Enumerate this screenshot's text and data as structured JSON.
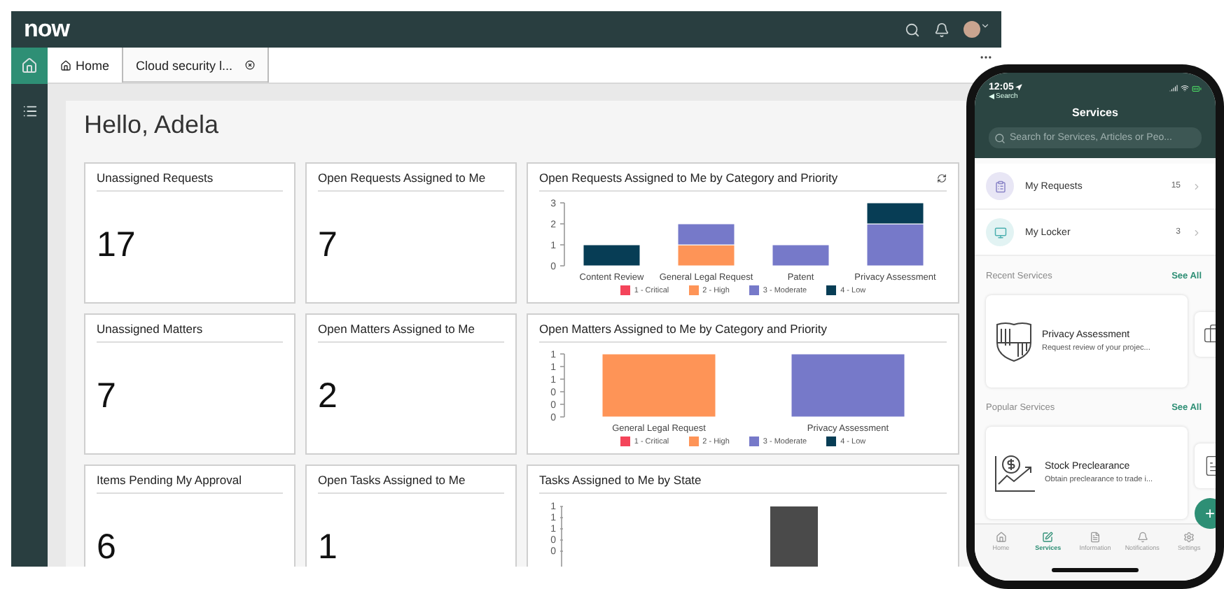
{
  "app": {
    "logo": "now",
    "tabs": [
      {
        "label": "Home",
        "selected": true,
        "closable": false
      },
      {
        "label": "Cloud security l...",
        "selected": false,
        "closable": true
      }
    ]
  },
  "greeting": "Hello, Adela",
  "widgets": [
    {
      "kind": "stat",
      "title": "Unassigned Requests",
      "value": "17"
    },
    {
      "kind": "stat",
      "title": "Open Requests Assigned to Me",
      "value": "7"
    },
    {
      "kind": "chart",
      "title": "Open Requests Assigned to Me by Category and Priority",
      "refresh": true,
      "chart_data": {
        "type": "bar",
        "stacked": true,
        "categories": [
          "Content Review",
          "General Legal Request",
          "Patent",
          "Privacy Assessment"
        ],
        "ylim": [
          0,
          3
        ],
        "yticks": [
          0,
          1,
          2,
          3
        ],
        "series": [
          {
            "name": "1 - Critical",
            "color": "#f4445a",
            "values": [
              0,
              0,
              0,
              0
            ]
          },
          {
            "name": "2 - High",
            "color": "#fe9457",
            "values": [
              0,
              1,
              0,
              0
            ]
          },
          {
            "name": "3 - Moderate",
            "color": "#7679c9",
            "values": [
              0,
              1,
              1,
              2
            ]
          },
          {
            "name": "4 - Low",
            "color": "#073d55",
            "values": [
              1,
              0,
              0,
              1
            ]
          }
        ]
      }
    },
    {
      "kind": "stat",
      "title": "Unassigned Matters",
      "value": "7"
    },
    {
      "kind": "stat",
      "title": "Open Matters Assigned to Me",
      "value": "2"
    },
    {
      "kind": "chart",
      "title": "Open Matters Assigned to Me by Category and Priority",
      "refresh": false,
      "chart_data": {
        "type": "bar",
        "stacked": true,
        "categories": [
          "General Legal Request",
          "Privacy Assessment"
        ],
        "ylim": [
          0,
          1
        ],
        "yticks": [
          {
            "value": 0,
            "label": "0"
          },
          {
            "value": 0.2,
            "label": "0"
          },
          {
            "value": 0.4,
            "label": "0"
          },
          {
            "value": 0.6,
            "label": "1"
          },
          {
            "value": 0.8,
            "label": "1"
          },
          {
            "value": 1,
            "label": "1"
          }
        ],
        "series": [
          {
            "name": "1 - Critical",
            "color": "#f4445a",
            "values": [
              0,
              0
            ]
          },
          {
            "name": "2 - High",
            "color": "#fe9457",
            "values": [
              1,
              0
            ]
          },
          {
            "name": "3 - Moderate",
            "color": "#7679c9",
            "values": [
              0,
              1
            ]
          },
          {
            "name": "4 - Low",
            "color": "#073d55",
            "values": [
              0,
              0
            ]
          }
        ]
      }
    },
    {
      "kind": "stat",
      "title": "Items Pending My Approval",
      "value": "6"
    },
    {
      "kind": "stat",
      "title": "Open Tasks Assigned to Me",
      "value": "1"
    },
    {
      "kind": "chart-picture",
      "title": "Tasks Assigned to Me by State",
      "refresh": false,
      "axis_labels": [
        "1",
        "1",
        "1",
        "0",
        "0"
      ]
    }
  ],
  "phone": {
    "time": "12:05",
    "back": "Search",
    "title": "Services",
    "search_placeholder": "Search for Services, Articles or Peo...",
    "shortcuts": [
      {
        "kind": "requests",
        "label": "My Requests",
        "count": "15",
        "color": "#e8e6f5"
      },
      {
        "kind": "locker",
        "label": "My Locker",
        "count": "3",
        "color": "#e2f3f3"
      }
    ],
    "sections": [
      {
        "title": "Recent Services",
        "action": "See All",
        "cards": [
          {
            "kind": "shield",
            "title": "Privacy Assessment",
            "description": "Request review of your projec..."
          },
          {
            "kind": "briefcase"
          }
        ]
      },
      {
        "title": "Popular Services",
        "action": "See All",
        "cards": [
          {
            "kind": "stock",
            "title": "Stock Preclearance",
            "description": "Obtain preclearance to trade i..."
          },
          {
            "kind": "document"
          }
        ]
      }
    ],
    "fab": "+",
    "nav": [
      {
        "label": "Home",
        "selected": false
      },
      {
        "label": "Services",
        "selected": true
      },
      {
        "label": "Information",
        "selected": false
      },
      {
        "label": "Notifications",
        "selected": false
      },
      {
        "label": "Settings",
        "selected": false
      }
    ]
  }
}
